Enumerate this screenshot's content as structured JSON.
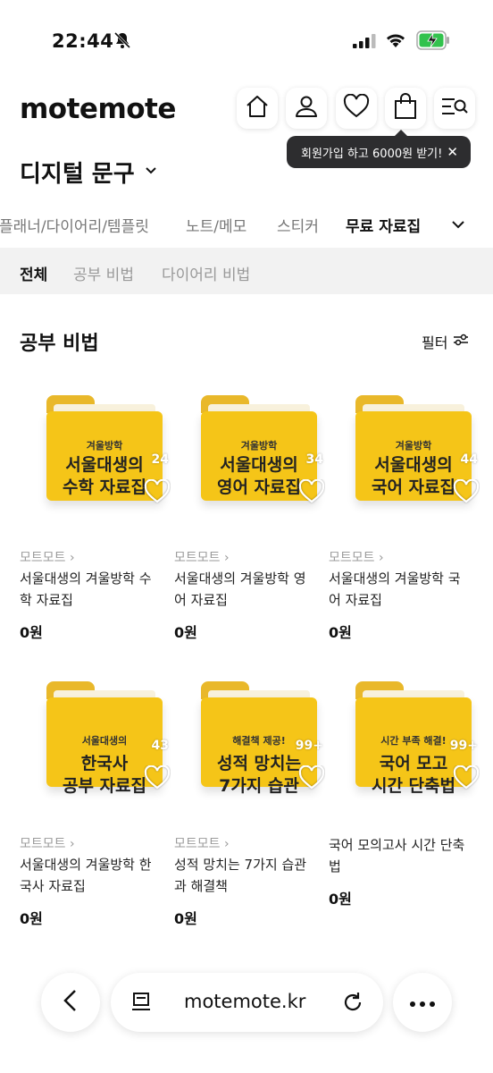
{
  "status": {
    "time": "22:44"
  },
  "header": {
    "logo": "motemote",
    "tooltip": "회원가입 하고 6000원 받기!",
    "tooltip_close": "✕",
    "category_title": "디지털 문구"
  },
  "tabs": [
    "플래너/다이어리/템플릿",
    "노트/메모",
    "스티커",
    "무료 자료집"
  ],
  "active_tab": "무료 자료집",
  "subtabs": [
    "전체",
    "공부 비법",
    "다이어리 비법"
  ],
  "section": {
    "title": "공부 비법",
    "filter_label": "필터"
  },
  "products": [
    {
      "thumb_small": "겨울방학",
      "thumb_line1": "서울대생의",
      "thumb_line2": "수학 자료집",
      "likes": "24",
      "brand": "모트모트 ›",
      "name": "서울대생의 겨울방학 수학 자료집",
      "price": "0원"
    },
    {
      "thumb_small": "겨울방학",
      "thumb_line1": "서울대생의",
      "thumb_line2": "영어 자료집",
      "likes": "34",
      "brand": "모트모트 ›",
      "name": "서울대생의 겨울방학 영어 자료집",
      "price": "0원"
    },
    {
      "thumb_small": "겨울방학",
      "thumb_line1": "서울대생의",
      "thumb_line2": "국어 자료집",
      "likes": "44",
      "brand": "모트모트 ›",
      "name": "서울대생의 겨울방학 국어 자료집",
      "price": "0원"
    },
    {
      "thumb_small": "서울대생의",
      "thumb_line1": "한국사",
      "thumb_line2": "공부 자료집",
      "likes": "43",
      "brand": "모트모트 ›",
      "name": "서울대생의 겨울방학 한국사 자료집",
      "price": "0원"
    },
    {
      "thumb_small": "해결책 제공!",
      "thumb_line1": "성적 망치는",
      "thumb_line2": "7가지 습관",
      "likes": "99+",
      "brand": "모트모트 ›",
      "name": "성적 망치는 7가지 습관과 해결책",
      "price": "0원"
    },
    {
      "thumb_small": "시간 부족 해결!",
      "thumb_line1": "국어 모고",
      "thumb_line2": "시간 단축법",
      "likes": "99+",
      "brand": "",
      "name": "국어 모의고사 시간 단축법",
      "price": "0원"
    }
  ],
  "browser": {
    "url": "motemote.kr"
  },
  "colors": {
    "folder": "#f5c518",
    "tooltip_bg": "#2d2d2f"
  }
}
